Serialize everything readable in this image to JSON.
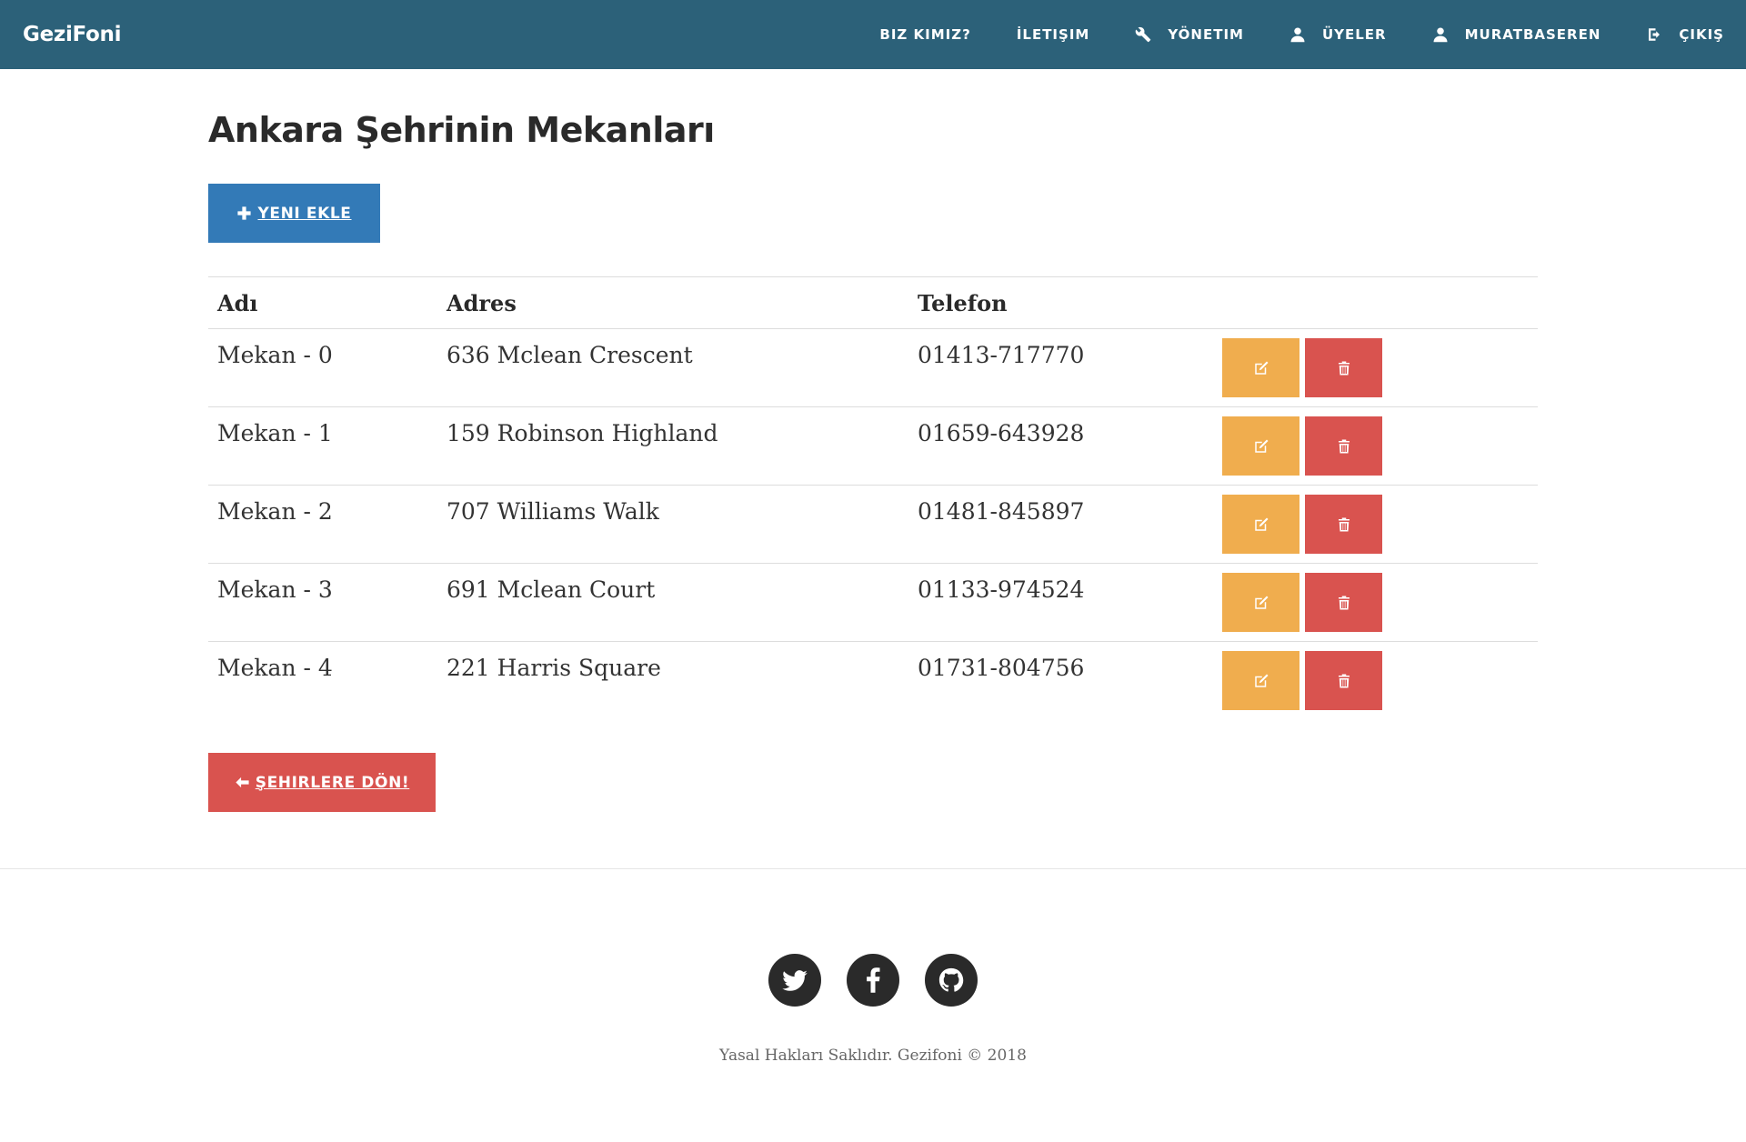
{
  "navbar": {
    "brand": "GeziFoni",
    "items": [
      {
        "label": "BIZ KIMIZ?",
        "icon": ""
      },
      {
        "label": "İLETIŞIM",
        "icon": ""
      },
      {
        "label": "YÖNETIM",
        "icon": "wrench-icon"
      },
      {
        "label": "ÜYELER",
        "icon": "user-icon"
      },
      {
        "label": "MURATBASEREN",
        "icon": "user-icon"
      },
      {
        "label": "ÇIKIŞ",
        "icon": "logout-icon"
      }
    ]
  },
  "main": {
    "title": "Ankara Şehrinin Mekanları",
    "add_button_label": "YENI EKLE",
    "back_button_label": "ŞEHIRLERE DÖN!",
    "table": {
      "headers": [
        "Adı",
        "Adres",
        "Telefon"
      ],
      "rows": [
        {
          "name": "Mekan - 0",
          "address": "636 Mclean Crescent",
          "phone": "01413-717770"
        },
        {
          "name": "Mekan - 1",
          "address": "159 Robinson Highland",
          "phone": "01659-643928"
        },
        {
          "name": "Mekan - 2",
          "address": "707 Williams Walk",
          "phone": "01481-845897"
        },
        {
          "name": "Mekan - 3",
          "address": "691 Mclean Court",
          "phone": "01133-974524"
        },
        {
          "name": "Mekan - 4",
          "address": "221 Harris Square",
          "phone": "01731-804756"
        }
      ]
    }
  },
  "footer": {
    "socials": [
      "twitter-icon",
      "facebook-icon",
      "github-icon"
    ],
    "copyright": "Yasal Hakları Saklıdır. Gezifoni © 2018"
  },
  "colors": {
    "navbar": "#2c6179",
    "primary": "#337ab7",
    "warning": "#f0ad4e",
    "danger": "#d9534f"
  }
}
